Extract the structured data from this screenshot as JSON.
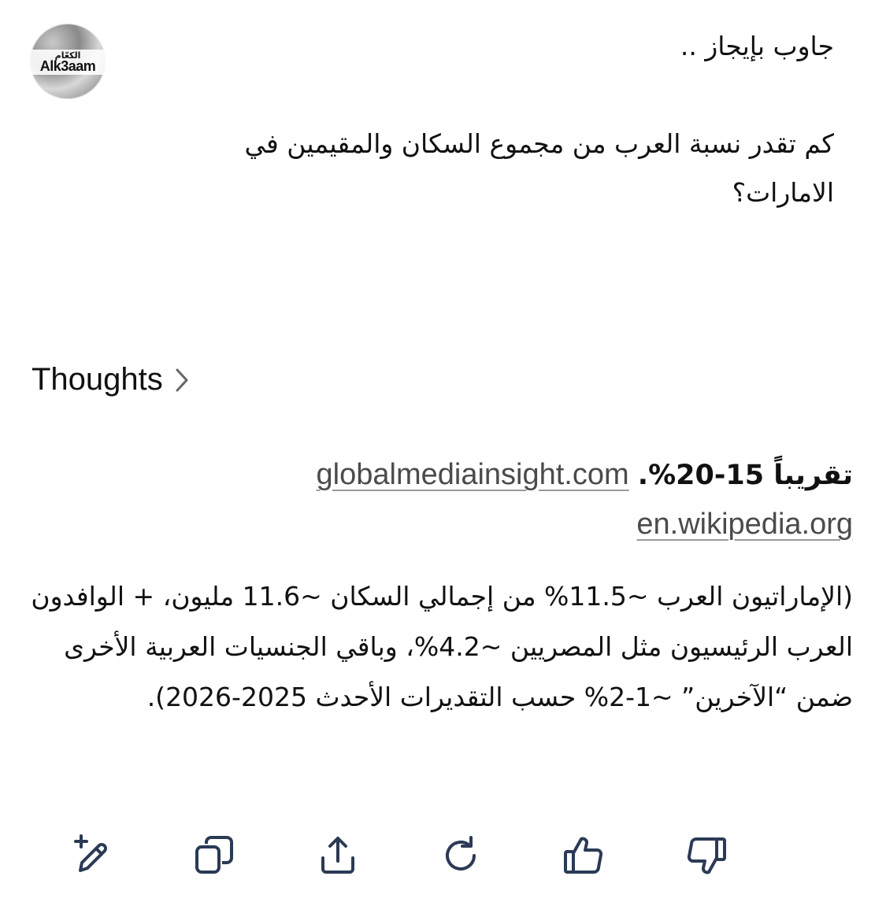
{
  "avatar": {
    "brand_ar": "الكعّام",
    "brand_en": "Alk3aam"
  },
  "prompt": {
    "line1": "جاوب بإيجاز ..",
    "line2": "كم تقدر نسبة العرب من مجموع السكان والمقيمين في الامارات؟"
  },
  "thoughts": {
    "label": "Thoughts"
  },
  "answer": {
    "headline": "تقريباً 15-20%.",
    "sources": [
      "globalmediainsight.com",
      "en.wikipedia.org"
    ],
    "body": "(الإماراتيون العرب ~11.5% من إجمالي السكان ~11.6 مليون، + الوافدون العرب الرئيسيون مثل المصريين ~4.2%، وباقي الجنسيات العربية الأخرى ضمن “الآخرين” ~1-2% حسب التقديرات الأحدث 2025-2026)."
  },
  "actions": [
    {
      "icon": "edit-sparkle-icon"
    },
    {
      "icon": "copy-icon"
    },
    {
      "icon": "share-icon"
    },
    {
      "icon": "regenerate-icon"
    },
    {
      "icon": "thumbs-up-icon"
    },
    {
      "icon": "thumbs-down-icon"
    }
  ],
  "colors": {
    "text": "#111111",
    "link": "#4b4b4b",
    "icon": "#2b3a55"
  }
}
